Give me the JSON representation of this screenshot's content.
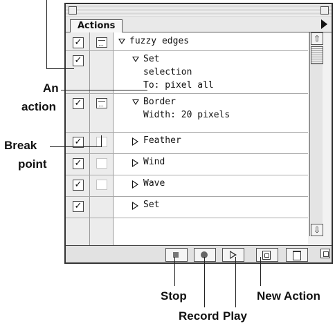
{
  "palette": {
    "tab_label": "Actions",
    "rows": [
      {
        "checked": true,
        "dialog": "on",
        "expanded": true,
        "level": 0,
        "lines": [
          "fuzzy edges"
        ]
      },
      {
        "checked": true,
        "dialog": "none",
        "expanded": true,
        "level": 1,
        "lines": [
          "Set",
          "selection",
          "To: pixel all"
        ]
      },
      {
        "checked": true,
        "dialog": "on",
        "expanded": true,
        "level": 1,
        "lines": [
          "Border",
          "Width: 20 pixels"
        ]
      },
      {
        "checked": true,
        "dialog": "off",
        "expanded": false,
        "level": 1,
        "lines": [
          "Feather"
        ]
      },
      {
        "checked": true,
        "dialog": "off",
        "expanded": false,
        "level": 1,
        "lines": [
          "Wind"
        ]
      },
      {
        "checked": true,
        "dialog": "off",
        "expanded": false,
        "level": 1,
        "lines": [
          "Wave"
        ]
      },
      {
        "checked": true,
        "dialog": "none",
        "expanded": false,
        "level": 1,
        "lines": [
          "Set"
        ]
      }
    ],
    "check_glyph": "✓",
    "toolbar": [
      "stop-icon",
      "record-icon",
      "play-icon",
      "new-action-icon",
      "trash-icon"
    ]
  },
  "callouts": {
    "action": "An action",
    "action_line1": "An",
    "action_line2": "action",
    "breakpoint_line1": "Break",
    "breakpoint_line2": "point",
    "stop": "Stop",
    "record": "Record",
    "play": "Play",
    "new_action": "New Action"
  }
}
